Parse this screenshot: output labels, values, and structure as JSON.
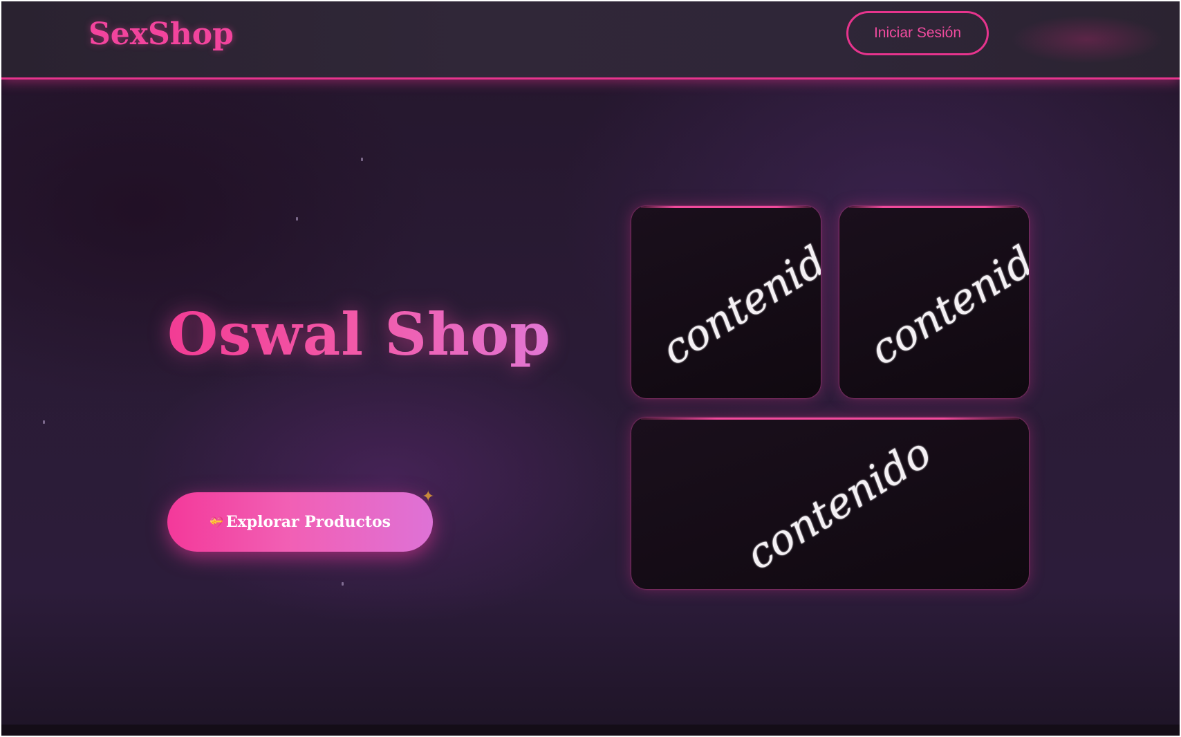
{
  "header": {
    "brand": "SexShop",
    "login_label": "Iniciar Sesión"
  },
  "hero": {
    "title": "Oswal Shop",
    "cta_icon": "💝",
    "cta_label": "Explorar Productos",
    "sparkle": "✦"
  },
  "cards": [
    {
      "label": "contenido"
    },
    {
      "label": "contenido"
    },
    {
      "label": "contenido"
    }
  ],
  "colors": {
    "accent": "#e6348d",
    "title": "#f0459f",
    "background": "#2a1b35",
    "card": "#140b15"
  }
}
